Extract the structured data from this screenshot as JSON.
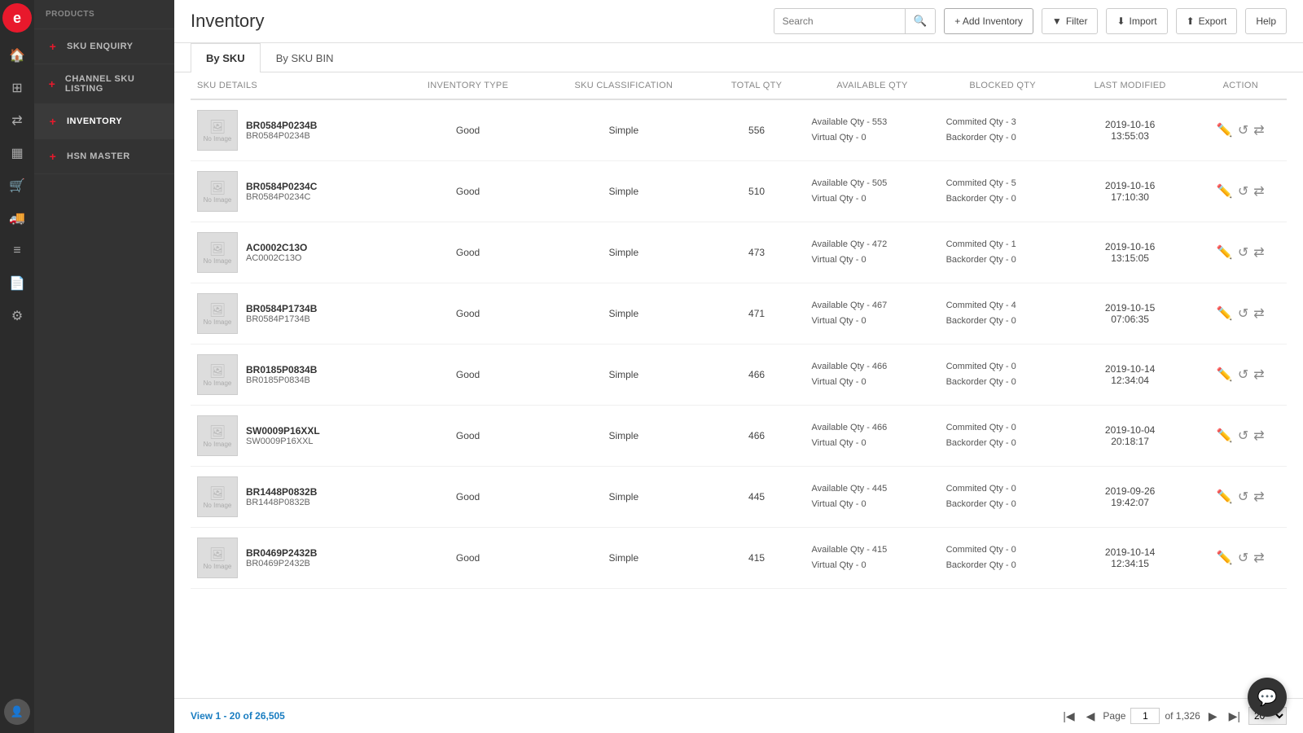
{
  "app": {
    "logo": "e",
    "title": "Inventory"
  },
  "iconBar": {
    "icons": [
      {
        "name": "store-icon",
        "symbol": "🏠"
      },
      {
        "name": "grid-icon",
        "symbol": "⊞"
      },
      {
        "name": "shuffle-icon",
        "symbol": "⇄"
      },
      {
        "name": "barcode-icon",
        "symbol": "▦"
      },
      {
        "name": "cart-icon",
        "symbol": "🛒"
      },
      {
        "name": "truck-icon",
        "symbol": "🚚"
      },
      {
        "name": "list-icon",
        "symbol": "≡"
      },
      {
        "name": "document-icon",
        "symbol": "📄"
      },
      {
        "name": "settings-icon",
        "symbol": "⚙"
      }
    ]
  },
  "sidebar": {
    "items": [
      {
        "label": "SKU Enquiry",
        "icon": "+",
        "active": false
      },
      {
        "label": "Channel SKU Listing",
        "icon": "+",
        "active": false
      },
      {
        "label": "Inventory",
        "icon": "+",
        "active": true
      },
      {
        "label": "HSN Master",
        "icon": "+",
        "active": false
      }
    ],
    "section": "PRODUCTS"
  },
  "header": {
    "title": "Inventory",
    "searchPlaceholder": "Search",
    "buttons": {
      "add": "+ Add Inventory",
      "filter": "Filter",
      "import": "Import",
      "export": "Export",
      "help": "Help"
    }
  },
  "tabs": [
    {
      "label": "By SKU",
      "active": true
    },
    {
      "label": "By SKU BIN",
      "active": false
    }
  ],
  "table": {
    "columns": [
      {
        "key": "sku_details",
        "label": "SKU DETAILS"
      },
      {
        "key": "inventory_type",
        "label": "INVENTORY TYPE"
      },
      {
        "key": "sku_classification",
        "label": "SKU CLASSIFICATION"
      },
      {
        "key": "total_qty",
        "label": "TOTAL QTY"
      },
      {
        "key": "available_qty",
        "label": "AVAILABLE QTY"
      },
      {
        "key": "blocked_qty",
        "label": "BLOCKED QTY"
      },
      {
        "key": "last_modified",
        "label": "LAST MODIFIED"
      },
      {
        "key": "action",
        "label": "ACTION"
      }
    ],
    "rows": [
      {
        "sku_name": "BR0584P0234B",
        "sku_code": "BR0584P0234B",
        "inventory_type": "Good",
        "sku_classification": "Simple",
        "total_qty": "556",
        "avail_qty": "Available Qty  - 553",
        "virtual_qty": "Virtual Qty - 0",
        "committed_qty": "Commited Qty - 3",
        "backorder_qty": "Backorder Qty - 0",
        "last_modified": "2019-10-16",
        "last_modified_time": "13:55:03"
      },
      {
        "sku_name": "BR0584P0234C",
        "sku_code": "BR0584P0234C",
        "inventory_type": "Good",
        "sku_classification": "Simple",
        "total_qty": "510",
        "avail_qty": "Available Qty  - 505",
        "virtual_qty": "Virtual Qty - 0",
        "committed_qty": "Commited Qty - 5",
        "backorder_qty": "Backorder Qty - 0",
        "last_modified": "2019-10-16",
        "last_modified_time": "17:10:30"
      },
      {
        "sku_name": "AC0002C13O",
        "sku_code": "AC0002C13O",
        "inventory_type": "Good",
        "sku_classification": "Simple",
        "total_qty": "473",
        "avail_qty": "Available Qty  - 472",
        "virtual_qty": "Virtual Qty - 0",
        "committed_qty": "Commited Qty - 1",
        "backorder_qty": "Backorder Qty - 0",
        "last_modified": "2019-10-16",
        "last_modified_time": "13:15:05"
      },
      {
        "sku_name": "BR0584P1734B",
        "sku_code": "BR0584P1734B",
        "inventory_type": "Good",
        "sku_classification": "Simple",
        "total_qty": "471",
        "avail_qty": "Available Qty  - 467",
        "virtual_qty": "Virtual Qty - 0",
        "committed_qty": "Commited Qty - 4",
        "backorder_qty": "Backorder Qty - 0",
        "last_modified": "2019-10-15",
        "last_modified_time": "07:06:35"
      },
      {
        "sku_name": "BR0185P0834B",
        "sku_code": "BR0185P0834B",
        "inventory_type": "Good",
        "sku_classification": "Simple",
        "total_qty": "466",
        "avail_qty": "Available Qty  - 466",
        "virtual_qty": "Virtual Qty - 0",
        "committed_qty": "Commited Qty - 0",
        "backorder_qty": "Backorder Qty - 0",
        "last_modified": "2019-10-14",
        "last_modified_time": "12:34:04"
      },
      {
        "sku_name": "SW0009P16XXL",
        "sku_code": "SW0009P16XXL",
        "inventory_type": "Good",
        "sku_classification": "Simple",
        "total_qty": "466",
        "avail_qty": "Available Qty  - 466",
        "virtual_qty": "Virtual Qty - 0",
        "committed_qty": "Commited Qty - 0",
        "backorder_qty": "Backorder Qty - 0",
        "last_modified": "2019-10-04",
        "last_modified_time": "20:18:17"
      },
      {
        "sku_name": "BR1448P0832B",
        "sku_code": "BR1448P0832B",
        "inventory_type": "Good",
        "sku_classification": "Simple",
        "total_qty": "445",
        "avail_qty": "Available Qty  - 445",
        "virtual_qty": "Virtual Qty - 0",
        "committed_qty": "Commited Qty - 0",
        "backorder_qty": "Backorder Qty - 0",
        "last_modified": "2019-09-26",
        "last_modified_time": "19:42:07"
      },
      {
        "sku_name": "BR0469P2432B",
        "sku_code": "BR0469P2432B",
        "inventory_type": "Good",
        "sku_classification": "Simple",
        "total_qty": "415",
        "avail_qty": "Available Qty  - 415",
        "virtual_qty": "Virtual Qty - 0",
        "committed_qty": "Commited Qty - 0",
        "backorder_qty": "Backorder Qty - 0",
        "last_modified": "2019-10-14",
        "last_modified_time": "12:34:15"
      }
    ]
  },
  "pagination": {
    "view_label": "View 1 - 20 of 26,505",
    "page_label": "Page",
    "page_value": "1",
    "total_pages": "of 1,326",
    "per_page_value": "20"
  },
  "colors": {
    "accent": "#e8192c",
    "link": "#1a7dc1",
    "sidebar_bg": "#333",
    "iconbar_bg": "#2b2b2b"
  }
}
